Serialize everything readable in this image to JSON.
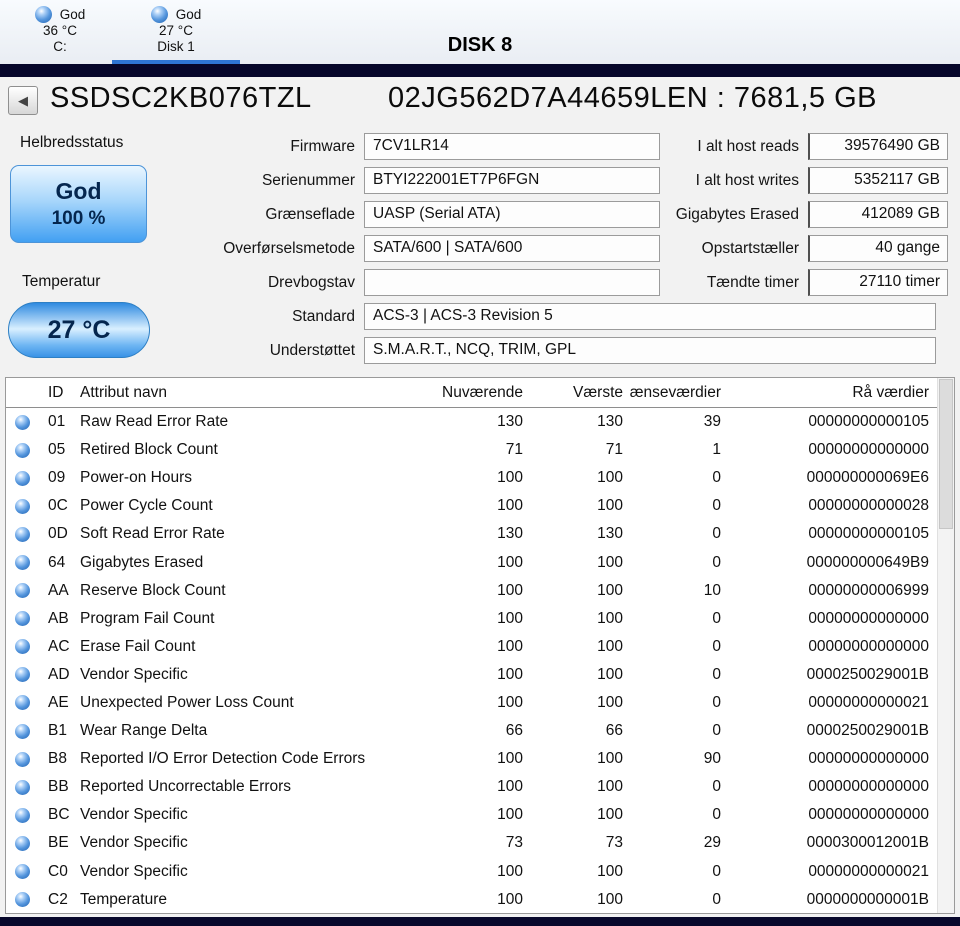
{
  "window": {
    "title": "DISK 8",
    "tabs": [
      {
        "status": "God",
        "temp": "36 °C",
        "name": "C:"
      },
      {
        "status": "God",
        "temp": "27 °C",
        "name": "Disk 1"
      }
    ]
  },
  "header": {
    "back": "◀",
    "model": "SSDSC2KB076TZL",
    "serial": "02JG562D7A44659LEN : 7681,5 GB"
  },
  "health": {
    "label": "Helbredsstatus",
    "status": "God",
    "percent": "100 %"
  },
  "temperature": {
    "label": "Temperatur",
    "value": "27 °C"
  },
  "info_left": [
    {
      "label": "Firmware",
      "value": "7CV1LR14"
    },
    {
      "label": "Serienummer",
      "value": "BTYI222001ET7P6FGN"
    },
    {
      "label": "Grænseflade",
      "value": "UASP (Serial ATA)"
    },
    {
      "label": "Overførselsmetode",
      "value": "SATA/600 | SATA/600"
    },
    {
      "label": "Drevbogstav",
      "value": ""
    },
    {
      "label": "Standard",
      "value": "ACS-3 | ACS-3 Revision 5"
    },
    {
      "label": "Understøttet",
      "value": "S.M.A.R.T., NCQ, TRIM, GPL"
    }
  ],
  "info_right": [
    {
      "label": "I alt host reads",
      "value": "39576490 GB"
    },
    {
      "label": "I alt host writes",
      "value": "5352117 GB"
    },
    {
      "label": "Gigabytes Erased",
      "value": "412089 GB"
    },
    {
      "label": "Opstartstæller",
      "value": "40 gange"
    },
    {
      "label": "Tændte timer",
      "value": "27110 timer"
    }
  ],
  "table": {
    "headers": {
      "id": "ID",
      "name": "Attribut navn",
      "current": "Nuværende",
      "worst": "Værste",
      "threshold": "ænseværdier",
      "raw": "Rå værdier"
    },
    "rows": [
      {
        "id": "01",
        "name": "Raw Read Error Rate",
        "current": "130",
        "worst": "130",
        "threshold": "39",
        "raw": "00000000000105"
      },
      {
        "id": "05",
        "name": "Retired Block Count",
        "current": "71",
        "worst": "71",
        "threshold": "1",
        "raw": "00000000000000"
      },
      {
        "id": "09",
        "name": "Power-on Hours",
        "current": "100",
        "worst": "100",
        "threshold": "0",
        "raw": "000000000069E6"
      },
      {
        "id": "0C",
        "name": "Power Cycle Count",
        "current": "100",
        "worst": "100",
        "threshold": "0",
        "raw": "00000000000028"
      },
      {
        "id": "0D",
        "name": "Soft Read Error Rate",
        "current": "130",
        "worst": "130",
        "threshold": "0",
        "raw": "00000000000105"
      },
      {
        "id": "64",
        "name": "Gigabytes Erased",
        "current": "100",
        "worst": "100",
        "threshold": "0",
        "raw": "000000000649B9"
      },
      {
        "id": "AA",
        "name": "Reserve Block Count",
        "current": "100",
        "worst": "100",
        "threshold": "10",
        "raw": "00000000006999"
      },
      {
        "id": "AB",
        "name": "Program Fail Count",
        "current": "100",
        "worst": "100",
        "threshold": "0",
        "raw": "00000000000000"
      },
      {
        "id": "AC",
        "name": "Erase Fail Count",
        "current": "100",
        "worst": "100",
        "threshold": "0",
        "raw": "00000000000000"
      },
      {
        "id": "AD",
        "name": "Vendor Specific",
        "current": "100",
        "worst": "100",
        "threshold": "0",
        "raw": "0000250029001B"
      },
      {
        "id": "AE",
        "name": "Unexpected Power Loss Count",
        "current": "100",
        "worst": "100",
        "threshold": "0",
        "raw": "00000000000021"
      },
      {
        "id": "B1",
        "name": "Wear Range Delta",
        "current": "66",
        "worst": "66",
        "threshold": "0",
        "raw": "0000250029001B"
      },
      {
        "id": "B8",
        "name": "Reported I/O Error Detection Code Errors",
        "current": "100",
        "worst": "100",
        "threshold": "90",
        "raw": "00000000000000"
      },
      {
        "id": "BB",
        "name": "Reported Uncorrectable Errors",
        "current": "100",
        "worst": "100",
        "threshold": "0",
        "raw": "00000000000000"
      },
      {
        "id": "BC",
        "name": "Vendor Specific",
        "current": "100",
        "worst": "100",
        "threshold": "0",
        "raw": "00000000000000"
      },
      {
        "id": "BE",
        "name": "Vendor Specific",
        "current": "73",
        "worst": "73",
        "threshold": "29",
        "raw": "0000300012001B"
      },
      {
        "id": "C0",
        "name": "Vendor Specific",
        "current": "100",
        "worst": "100",
        "threshold": "0",
        "raw": "00000000000021"
      },
      {
        "id": "C2",
        "name": "Temperature",
        "current": "100",
        "worst": "100",
        "threshold": "0",
        "raw": "0000000000001B"
      }
    ]
  }
}
